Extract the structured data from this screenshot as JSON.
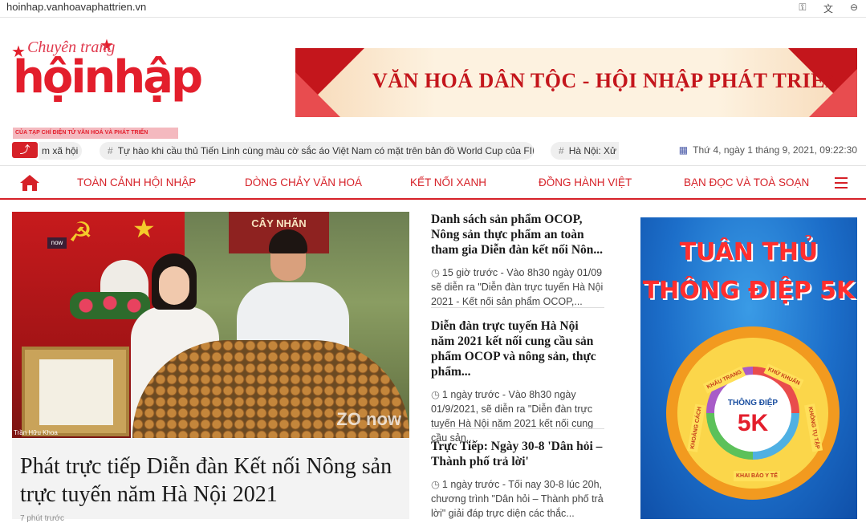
{
  "browser": {
    "url": "hoinhap.vanhoavaphattrien.vn",
    "icons": [
      "key-icon",
      "translate-icon",
      "zoom-icon"
    ]
  },
  "logo": {
    "top": "Chuyên trang",
    "main": "hộinhập",
    "sub": "CỦA TẠP CHÍ ĐIỆN TỬ VĂN HOÁ VÀ PHÁT TRIỂN"
  },
  "banner": {
    "text": "VĂN HOÁ DÂN TỘC - HỘI NHẬP PHÁT TRIỂN"
  },
  "ticker": {
    "items": [
      "m xã hội",
      "Tự hào khi cầu thủ Tiến Linh cùng màu cờ sắc áo Việt Nam có mặt trên bản đồ World Cup của FIFA",
      "Hà Nội: Xử"
    ],
    "date": "Thứ 4, ngày 1 tháng 9, 2021, 09:22:30"
  },
  "nav": {
    "items": [
      "TOÀN CẢNH HỘI NHẬP",
      "DÒNG CHẢY VĂN HOÁ",
      "KẾT NỐI XANH",
      "ĐỒNG HÀNH VIỆT",
      "BẠN ĐỌC VÀ TOÀ SOẠN"
    ]
  },
  "featured": {
    "sign": "CÂY NHÃN",
    "now_badge": "now",
    "watermark": "ZO now",
    "credit": "Trần Hữu Khoa",
    "title": "Phát trực tiếp Diễn đàn Kết nối Nông sản trực tuyến năm Hà Nội 2021",
    "time": "7 phút trước"
  },
  "news": [
    {
      "title": "Danh sách sản phẩm OCOP, Nông sản thực phẩm an toàn tham gia Diễn đàn kết nối Nôn...",
      "time": "15 giờ trước",
      "excerpt": " - Vào 8h30 ngày 01/09 sẽ diễn ra \"Diễn đàn trực tuyến Hà Nội 2021 - Kết nối sản phẩm OCOP,..."
    },
    {
      "title": "Diễn đàn trực tuyến Hà Nội năm 2021 kết nối cung cầu sản phẩm OCOP và nông sản, thực phẩm...",
      "time": "1 ngày trước",
      "excerpt": " - Vào 8h30 ngày 01/9/2021, sẽ diễn ra \"Diễn đàn trực tuyến Hà Nội năm 2021 kết nối cung cầu sản..."
    },
    {
      "title": "Trực Tiếp: Ngày 30-8 'Dân hỏi – Thành phố trả lời'",
      "time": "1 ngày trước",
      "excerpt": " - Tối nay 30-8 lúc 20h, chương trình \"Dân hỏi – Thành phố trả lời\" giải đáp trực diện các thắc..."
    }
  ],
  "ad": {
    "line1": "TUÂN THỦ",
    "line2": "THÔNG ĐIỆP 5K",
    "center_label": "THÔNG ĐIỆP",
    "center_big": "5K",
    "points": [
      "KHẨU TRANG",
      "KHỬ KHUẨN",
      "KHÔNG TỤ TẬP",
      "KHAI BÁO Y TẾ",
      "KHOẢNG CÁCH"
    ]
  },
  "colors": {
    "brand_red": "#d62128",
    "ad_blue": "#1c6ec9"
  }
}
